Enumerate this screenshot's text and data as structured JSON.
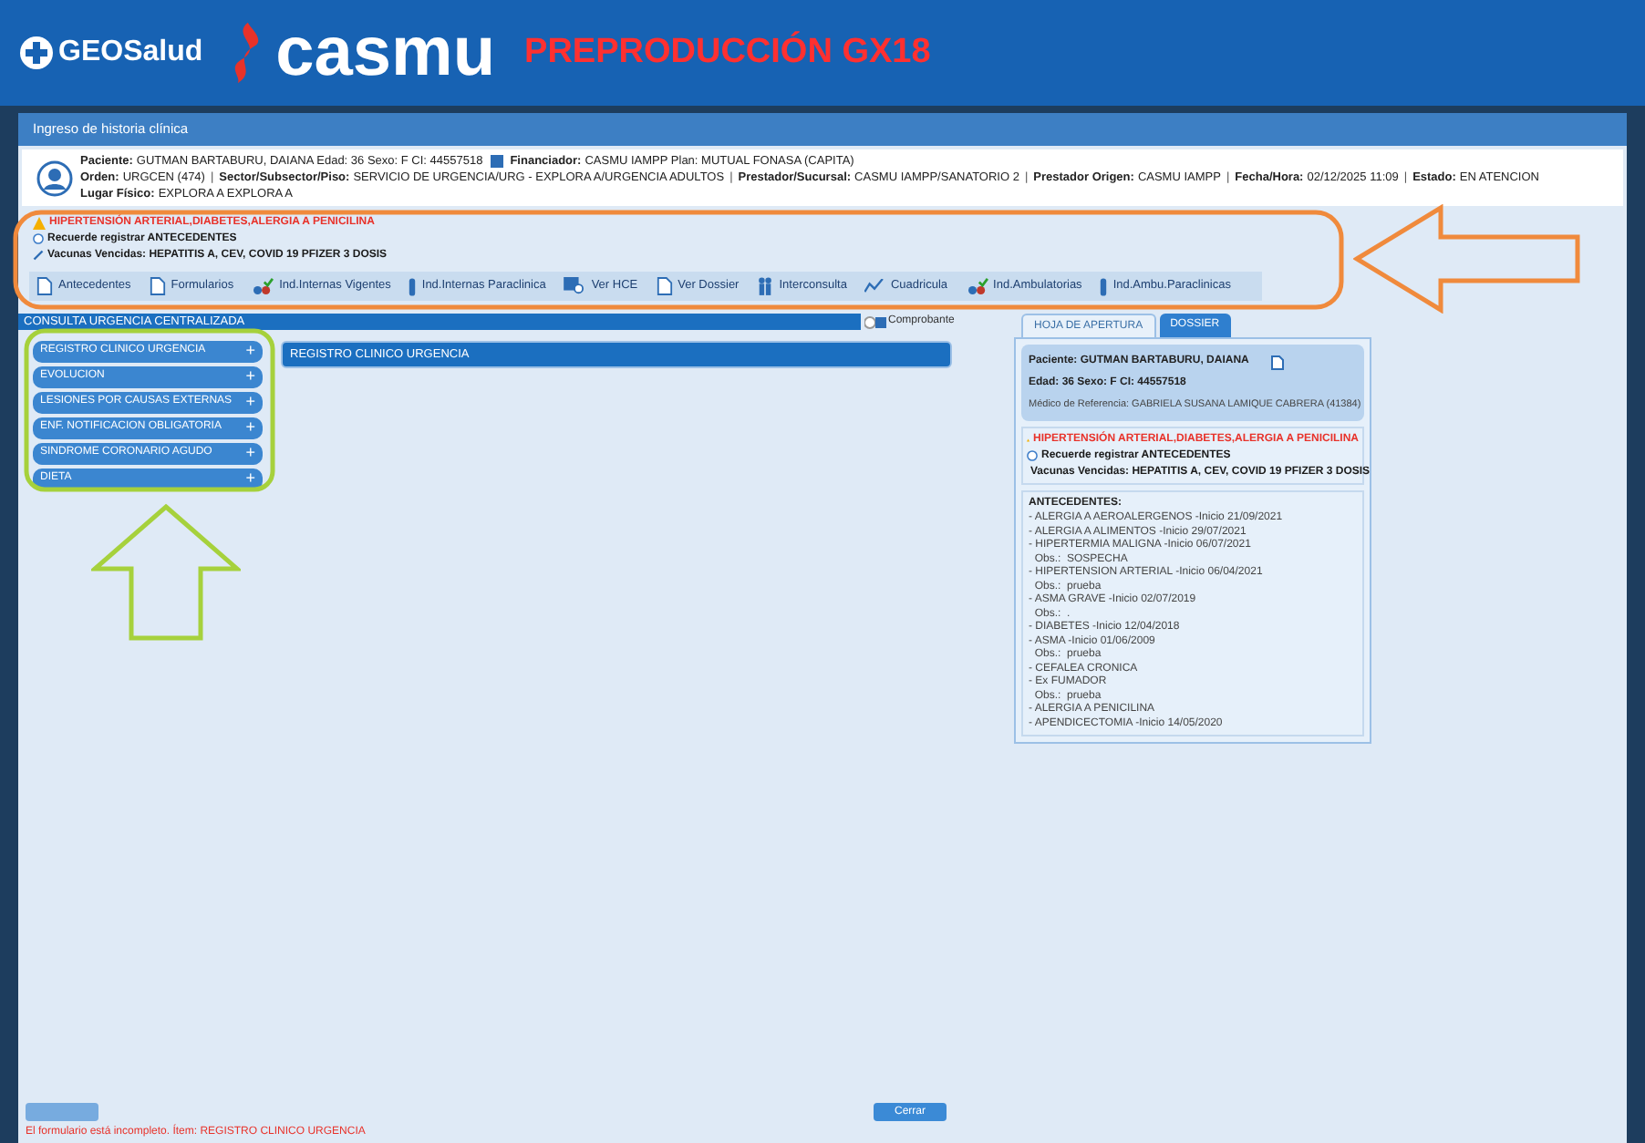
{
  "header": {
    "logo_text": "GEOSalud",
    "brand": "casmu",
    "environment": "PREPRODUCCIÓN GX18"
  },
  "window": {
    "title": "Ingreso de historia clínica"
  },
  "patient_info": {
    "separator": "|",
    "line1": [
      {
        "label": "Paciente:",
        "value": "GUTMAN BARTABURU, DAIANA Edad: 36 Sexo: F CI: 44557518"
      },
      {
        "label": "Financiador:",
        "value": "CASMU IAMPP Plan: MUTUAL FONASA (CAPITA)"
      }
    ],
    "line2": [
      {
        "label": "Orden:",
        "value": "URGCEN (474)"
      },
      {
        "label": "Sector/Subsector/Piso:",
        "value": "SERVICIO DE URGENCIA/URG - EXPLORA A/URGENCIA ADULTOS"
      },
      {
        "label": "Prestador/Sucursal:",
        "value": "CASMU IAMPP/SANATORIO 2"
      },
      {
        "label": "Prestador Origen:",
        "value": "CASMU IAMPP"
      },
      {
        "label": "Fecha/Hora:",
        "value": "02/12/2025 11:09"
      },
      {
        "label": "Estado:",
        "value": "EN ATENCION"
      }
    ],
    "line3": [
      {
        "label": "Lugar Físico:",
        "value": "EXPLORA A EXPLORA A"
      }
    ]
  },
  "alerts": [
    {
      "kind": "warning",
      "text": "HIPERTENSIÓN ARTERIAL,DIABETES,ALERGIA A PENICILINA"
    },
    {
      "kind": "info",
      "text": "Recuerde registrar ANTECEDENTES"
    },
    {
      "kind": "vaccine",
      "text": "Vacunas Vencidas: HEPATITIS A, CEV, COVID 19 PFIZER 3 DOSIS"
    }
  ],
  "toolbar": [
    {
      "kind": "doc",
      "label": "Antecedentes"
    },
    {
      "kind": "doc",
      "label": "Formularios"
    },
    {
      "kind": "drops",
      "label": "Ind.Internas Vigentes"
    },
    {
      "kind": "tube",
      "label": "Ind.Internas Paraclinica"
    },
    {
      "kind": "search",
      "label": "Ver HCE"
    },
    {
      "kind": "doc",
      "label": "Ver Dossier"
    },
    {
      "kind": "people",
      "label": "Interconsulta"
    },
    {
      "kind": "chart",
      "label": "Cuadricula"
    },
    {
      "kind": "drops",
      "label": "Ind.Ambulatorias"
    },
    {
      "kind": "tube",
      "label": "Ind.Ambu.Paraclinicas"
    }
  ],
  "section": {
    "title": "CONSULTA URGENCIA CENTRALIZADA",
    "comprobante": "Comprobante"
  },
  "accordion": [
    {
      "label": "REGISTRO CLINICO URGENCIA",
      "expander": "+",
      "selected": false
    },
    {
      "label": "EVOLUCION",
      "expander": "+",
      "selected": false
    },
    {
      "label": "LESIONES POR CAUSAS EXTERNAS",
      "expander": "+",
      "selected": false
    },
    {
      "label": "ENF. NOTIFICACION OBLIGATORIA",
      "expander": "+",
      "selected": false
    },
    {
      "label": "SINDROME CORONARIO AGUDO",
      "expander": "+",
      "selected": false
    },
    {
      "label": "DIETA",
      "expander": "+",
      "selected": false
    }
  ],
  "form_panel": {
    "title": "REGISTRO CLINICO URGENCIA"
  },
  "right_tabs": [
    {
      "label": "HOJA DE APERTURA",
      "selected": true
    },
    {
      "label": "DOSSIER",
      "selected": false
    }
  ],
  "patient_card": {
    "name": "Paciente: GUTMAN BARTABURU, DAIANA",
    "details": "Edad: 36 Sexo: F CI: 44557518",
    "doctor": "Médico de Referencia: GABRIELA SUSANA LAMIQUE CABRERA (41384)"
  },
  "card_alerts": [
    {
      "kind": "warning",
      "text": "HIPERTENSIÓN ARTERIAL,DIABETES,ALERGIA A PENICILINA"
    },
    {
      "kind": "info",
      "text": "Recuerde registrar ANTECEDENTES"
    },
    {
      "kind": "vaccine",
      "text": "Vacunas Vencidas: HEPATITIS A, CEV, COVID 19 PFIZER 3 DOSIS"
    }
  ],
  "antecedentes": {
    "title": "ANTECEDENTES:",
    "lines": [
      "- ALERGIA A AEROALERGENOS -Inicio 21/09/2021",
      "- ALERGIA A ALIMENTOS -Inicio 29/07/2021",
      "- HIPERTERMIA MALIGNA -Inicio 06/07/2021",
      "  Obs.:  SOSPECHA",
      "- HIPERTENSION ARTERIAL -Inicio 06/04/2021",
      "  Obs.:  prueba",
      "- ASMA GRAVE -Inicio 02/07/2019",
      "  Obs.:  .",
      "- DIABETES -Inicio 12/04/2018",
      "- ASMA -Inicio 01/06/2009",
      "  Obs.:  prueba",
      "- CEFALEA CRONICA",
      "- Ex FUMADOR",
      "  Obs.:  prueba",
      "- ALERGIA A PENICILINA",
      "- APENDICECTOMIA -Inicio 14/05/2020"
    ]
  },
  "footer": {
    "left_button": {
      "disabled": true
    },
    "close_button": "Cerrar",
    "message": "El formulario está incompleto. Ítem: REGISTRO CLINICO URGENCIA"
  }
}
